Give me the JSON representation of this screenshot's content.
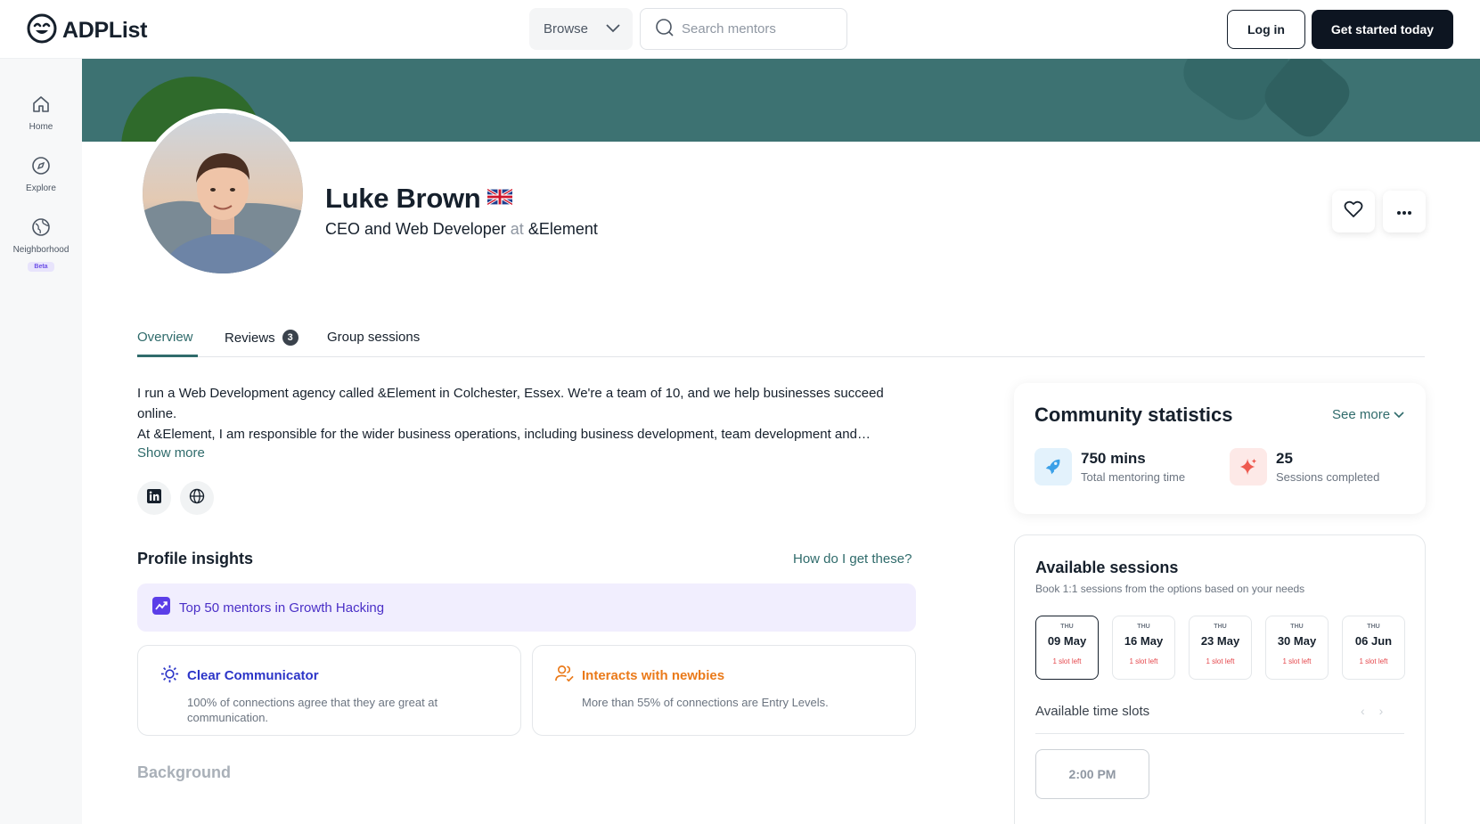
{
  "app": {
    "name": "ADPList",
    "colors": {
      "accent": "#2f6b6b",
      "banner": "#3d7272",
      "primary_dark": "#0d1521",
      "insight_purple": "#4a2fc7",
      "insight_orange": "#ea7a1a",
      "slot_red": "#e5484d"
    }
  },
  "header": {
    "browse_label": "Browse",
    "search_placeholder": "Search mentors",
    "login_label": "Log in",
    "get_started_label": "Get started today"
  },
  "sidebar": {
    "items": [
      {
        "label": "Home",
        "icon": "home-icon"
      },
      {
        "label": "Explore",
        "icon": "compass-icon"
      },
      {
        "label": "Neighborhood",
        "icon": "globe-icon",
        "badge": "Beta"
      }
    ]
  },
  "profile": {
    "name": "Luke Brown",
    "flag": "🇬🇧",
    "role": "CEO and Web Developer",
    "at": "at",
    "company": "&Element"
  },
  "tabs": [
    {
      "label": "Overview",
      "active": true
    },
    {
      "label": "Reviews",
      "count": "3"
    },
    {
      "label": "Group sessions"
    }
  ],
  "bio": {
    "line1": "I run a Web Development agency called &Element in Colchester, Essex. We're a team of 10, and we help businesses succeed online.",
    "line2": "At &Element, I am responsible for the wider business operations, including business development, team development and…",
    "show_more": "Show more"
  },
  "insights": {
    "title": "Profile insights",
    "link": "How do I get these?",
    "highlight": "Top 50 mentors in Growth Hacking",
    "cards": [
      {
        "title": "Clear Communicator",
        "desc": "100% of connections agree that they are great at communication.",
        "icon": "sun-icon"
      },
      {
        "title": "Interacts with newbies",
        "desc": "More than 55% of connections are Entry Levels.",
        "icon": "users-check-icon"
      }
    ]
  },
  "background": {
    "title": "Background"
  },
  "stats": {
    "title": "Community statistics",
    "see_more": "See more",
    "items": [
      {
        "value": "750 mins",
        "label": "Total mentoring time",
        "icon": "rocket-icon"
      },
      {
        "value": "25",
        "label": "Sessions completed",
        "icon": "sparkle-icon"
      }
    ]
  },
  "sessions": {
    "title": "Available sessions",
    "subtitle": "Book 1:1 sessions from the options based on your needs",
    "dates": [
      {
        "day": "THU",
        "date": "09 May",
        "slots": "1 slot left",
        "selected": true
      },
      {
        "day": "THU",
        "date": "16 May",
        "slots": "1 slot left"
      },
      {
        "day": "THU",
        "date": "23 May",
        "slots": "1 slot left"
      },
      {
        "day": "THU",
        "date": "30 May",
        "slots": "1 slot left"
      },
      {
        "day": "THU",
        "date": "06 Jun",
        "slots": "1 slot left"
      }
    ],
    "time_slots_label": "Available time slots",
    "time_slot": "2:00 PM"
  }
}
